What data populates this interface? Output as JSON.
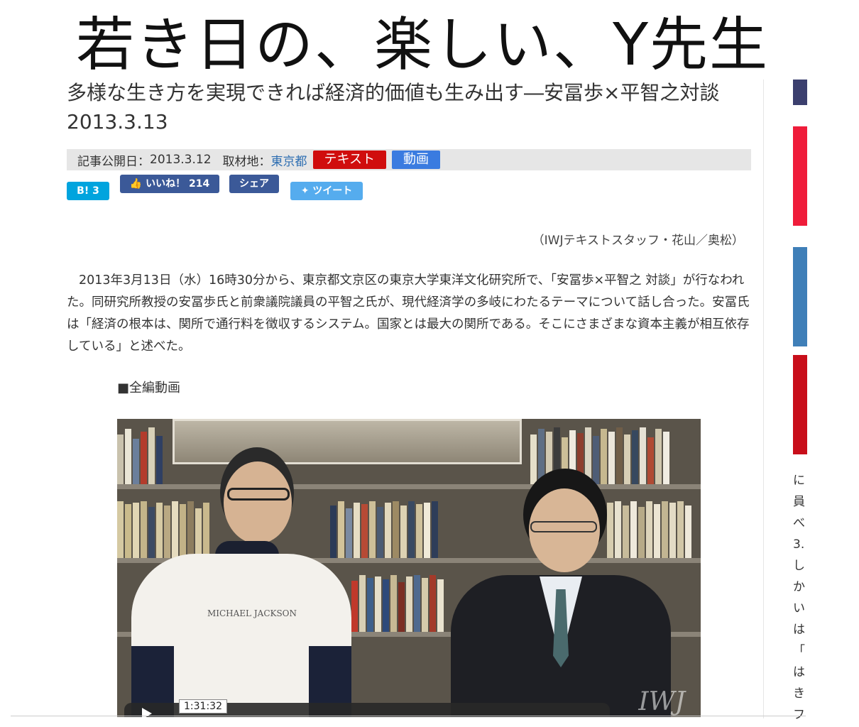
{
  "banner": "若き日の、楽しい、Y先生",
  "article": {
    "title": "多様な生き方を実現できれば経済的価値も生み出す―安冨歩×平智之対談 2013.3.13",
    "meta": {
      "published_label": "記事公開日：",
      "published_value": "2013.3.12",
      "location_label": "取材地：",
      "location_value": "東京都",
      "tag_text": "テキスト",
      "tag_video": "動画"
    },
    "social": {
      "hatena": "B! 3",
      "like": "いいね！ 214",
      "share": "シェア",
      "tweet": "ツイート"
    },
    "credit": "（IWJテキストスタッフ・花山／奥松）",
    "body": "2013年3月13日（水）16時30分から、東京都文京区の東京大学東洋文化研究所で、「安冨歩×平智之 対談」が行なわれた。同研究所教授の安冨歩氏と前衆議院議員の平智之氏が、現代経済学の多岐にわたるテーマについて話し合った。安冨氏は「経済の根本は、関所で通行料を徴収するシステム。国家とは最大の関所である。そこにさまざまな資本主義が相互依存している」と述べた。",
    "section_label": "■全編動画",
    "video": {
      "time": "1:31:32",
      "shirt_text": "MICHAEL JACKSON",
      "watermark": "IWJ"
    }
  },
  "sidebar": {
    "snippets": [
      "に",
      "員",
      "べ",
      "3.",
      "し",
      "か",
      "い",
      "は",
      "「",
      "は",
      "き",
      "フ"
    ]
  },
  "colors": {
    "tag_red": "#d00d0d",
    "tag_blue": "#3a7be0",
    "hatena": "#00a4de",
    "facebook": "#3b5998",
    "twitter": "#55acee"
  }
}
